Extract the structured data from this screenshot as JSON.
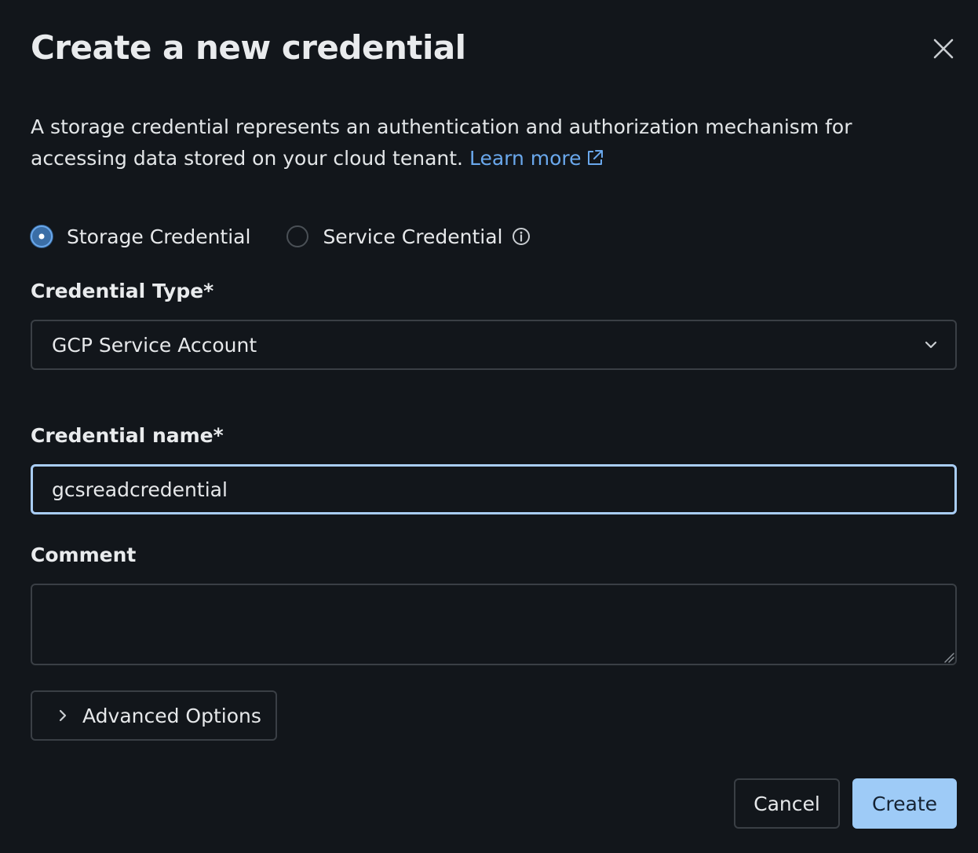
{
  "dialog": {
    "title": "Create a new credential",
    "description": "A storage credential represents an authentication and authorization mechanism for accessing data stored on your cloud tenant.",
    "learn_more": "Learn more"
  },
  "credential_kind": {
    "options": [
      {
        "label": "Storage Credential",
        "selected": true
      },
      {
        "label": "Service Credential",
        "selected": false
      }
    ]
  },
  "credential_type": {
    "label": "Credential Type*",
    "value": "GCP Service Account"
  },
  "credential_name": {
    "label": "Credential name*",
    "value": "gcsreadcredential"
  },
  "comment": {
    "label": "Comment",
    "value": ""
  },
  "advanced": {
    "label": "Advanced Options"
  },
  "footer": {
    "cancel_label": "Cancel",
    "create_label": "Create"
  },
  "icons": {
    "close": "close-icon",
    "external_link": "external-link-icon",
    "info": "info-icon",
    "select_chevron": "chevron-down-icon",
    "advanced_chevron": "chevron-right-icon"
  },
  "colors": {
    "background": "#12161b",
    "link": "#6aa8ec",
    "primary_button": "#9ecbf7",
    "focus_border": "#a9cdf5",
    "border": "#3a3f45"
  }
}
